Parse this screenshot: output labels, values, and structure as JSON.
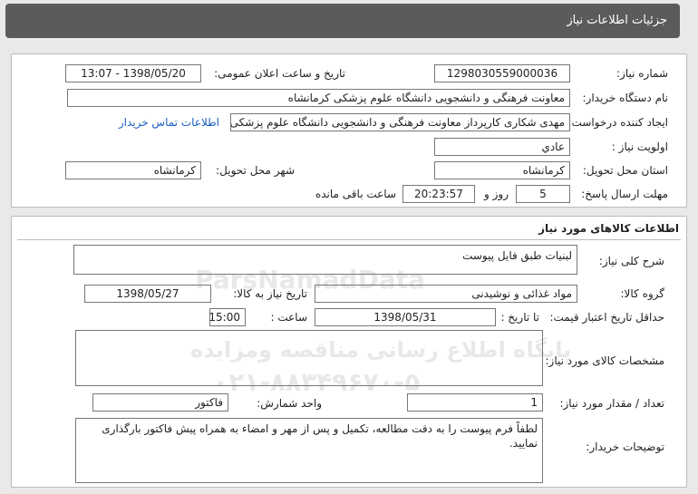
{
  "header": {
    "title": "جزئیات اطلاعات نیاز"
  },
  "info": {
    "need_number_label": "شماره نیاز:",
    "need_number": "1298030559000036",
    "announce_label": "تاریخ و ساعت اعلان عمومی:",
    "announce_value": "1398/05/20 - 13:07",
    "buyer_org_label": "نام دستگاه خریدار:",
    "buyer_org": "معاونت فرهنگی و دانشجویی دانشگاه علوم پزشکی کرمانشاه",
    "creator_label": "ایجاد کننده درخواست:",
    "creator": "مهدی شکاری کارپرداز معاونت فرهنگی و دانشجویی دانشگاه علوم پزشکی کرمانشاه",
    "contact_link": "اطلاعات تماس خریدار",
    "priority_label": "اولویت نیاز :",
    "priority": "عادي",
    "province_label": "استان محل تحویل:",
    "province": "کرمانشاه",
    "city_label": "شهر محل تحویل:",
    "city": "کرمانشاه",
    "deadline_label": "مهلت ارسال پاسخ:",
    "days": "5",
    "days_and": "روز و",
    "time": "20:23:57",
    "remaining": "ساعت باقی مانده"
  },
  "goods": {
    "section_title": "اطلاعات کالاهای مورد نیاز",
    "desc_label": "شرح کلی نیاز:",
    "desc": "لبنیات طبق فایل پیوست",
    "group_label": "گروه کالا:",
    "group": "مواد غذائی و نوشیدنی",
    "need_date_label": "تاریخ نیاز به کالا:",
    "need_date": "1398/05/27",
    "min_price_label": "حداقل تاریخ اعتبار قیمت:",
    "until_date_label": "تا تاریخ :",
    "until_date": "1398/05/31",
    "hour_label": "ساعت :",
    "hour": "15:00",
    "specs_label": "مشخصات کالای مورد نیاز:",
    "specs": "",
    "qty_label": "تعداد / مقدار مورد نیاز:",
    "qty": "1",
    "unit_label": "واحد شمارش:",
    "unit": "فاکتور",
    "notes_label": "توضیحات خریدار:",
    "notes": "لطفاً فرم پیوست را به دقت مطالعه، تکمیل و پس از مهر و امضاء به همراه پیش فاکتور بارگذاری نمایید."
  },
  "watermark": {
    "brand": "ParsNamadData",
    "line1": "پایگاه اطلاع رسانی مناقصه ومزایده",
    "line2": "۰۲۱-۸۸۳۴۹۶۷۰-۵"
  }
}
